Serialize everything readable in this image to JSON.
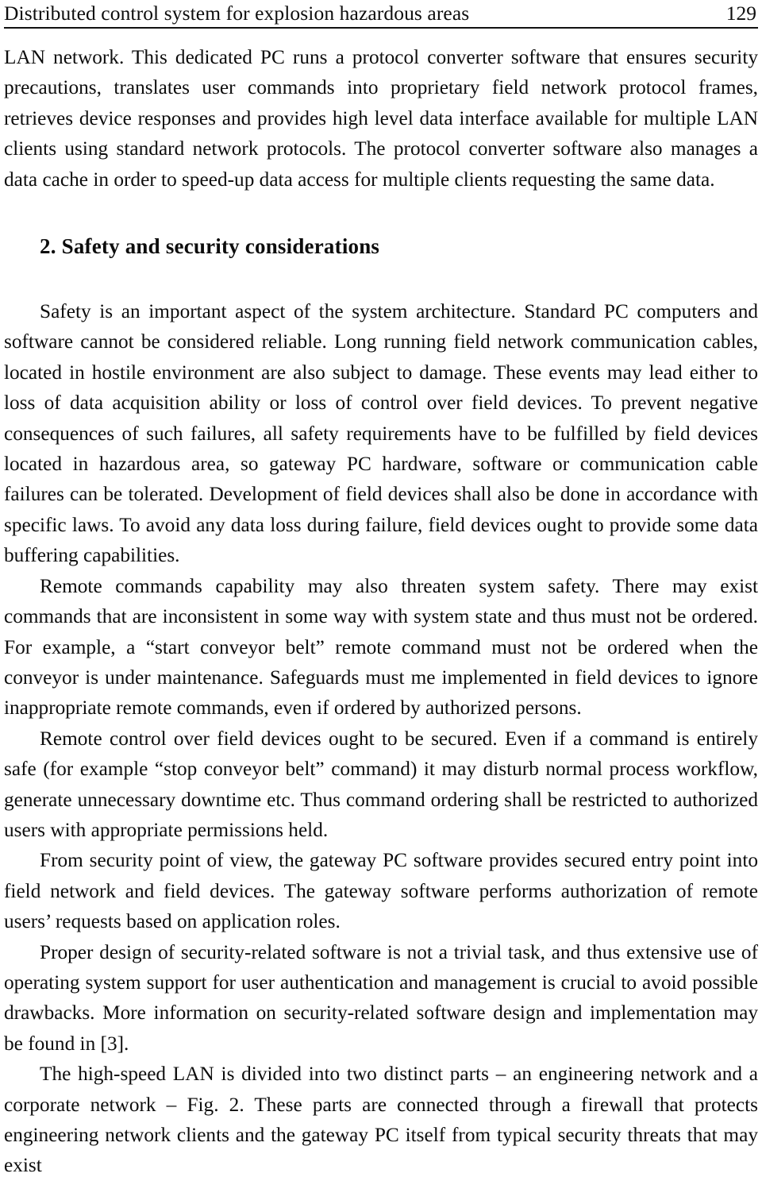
{
  "header": {
    "running_title": "Distributed control system for explosion hazardous areas",
    "page_number": "129"
  },
  "content": {
    "paragraph_1": "LAN network. This dedicated PC runs a protocol converter software that ensures security precautions, translates user commands into proprietary field network protocol frames, retrieves device responses and provides high level data interface available for multiple LAN clients using standard network protocols. The protocol converter software also manages a data cache in order to speed-up data access for multiple clients requesting the same data.",
    "section_heading": "2. Safety and security considerations",
    "paragraph_2": "Safety is an important aspect of the system architecture. Standard PC computers and software cannot be considered reliable. Long running field network communication cables, located in hostile environment are also subject to damage. These events may lead either to loss of data acquisition ability or loss of control over field devices. To prevent negative consequences of such failures, all safety requirements have to be fulfilled by field devices located in hazardous area, so gateway PC hardware, software or communication cable failures can be tolerated. Development of field devices shall also be done in accordance with specific laws. To avoid any data loss during failure, field devices ought to provide some data buffering capabilities.",
    "paragraph_3": "Remote commands capability may also threaten system safety. There may exist commands that are inconsistent in some way with system state and thus must not be ordered. For example, a “start conveyor belt” remote command must not be ordered when the conveyor is under maintenance. Safeguards must me implemented in field devices to ignore inappropriate remote commands, even if ordered by authorized persons.",
    "paragraph_4": "Remote control over field devices ought to be secured. Even if a command is entirely safe (for example “stop conveyor belt” command) it may disturb normal process workflow, generate unnecessary downtime etc. Thus command ordering shall be restricted to authorized users with appropriate permissions held.",
    "paragraph_5": "From security point of view, the gateway PC software provides secured entry point into field network and field devices. The gateway software performs authorization of remote users’ requests based on application roles.",
    "paragraph_6": "Proper design of security-related software is not a trivial task, and thus extensive use of operating system support for user authentication and management is crucial to avoid possible drawbacks. More information on security-related software design and implementation may be found in [3].",
    "paragraph_7": "The high-speed LAN is divided into two distinct parts – an engineering network and a corporate network – Fig. 2. These parts are connected through a firewall that protects engineering network clients and the gateway PC itself from typical security threats that may exist"
  }
}
